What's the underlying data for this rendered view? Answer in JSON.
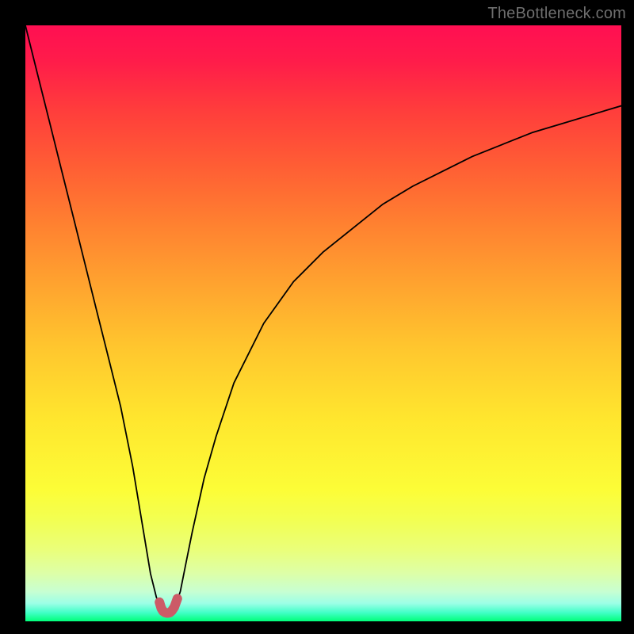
{
  "watermark": "TheBottleneck.com",
  "colors": {
    "background": "#000000",
    "curve_stroke": "#000000",
    "marker_stroke": "#cc5a67",
    "watermark": "#6e6e6e"
  },
  "chart_data": {
    "type": "line",
    "title": "",
    "xlabel": "",
    "ylabel": "",
    "xlim": [
      0,
      100
    ],
    "ylim": [
      0,
      100
    ],
    "grid": false,
    "series": [
      {
        "name": "bottleneck-curve",
        "x": [
          0,
          2,
          4,
          6,
          8,
          10,
          12,
          14,
          16,
          18,
          19,
          20,
          21,
          22,
          23,
          23.5,
          24,
          24.5,
          25,
          26,
          27,
          28,
          30,
          32,
          35,
          40,
          45,
          50,
          55,
          60,
          65,
          70,
          75,
          80,
          85,
          90,
          95,
          100
        ],
        "y": [
          100,
          92,
          84,
          76,
          68,
          60,
          52,
          44,
          36,
          26,
          20,
          14,
          8,
          4,
          2,
          1.5,
          1.4,
          1.5,
          2,
          5,
          10,
          15,
          24,
          31,
          40,
          50,
          57,
          62,
          66,
          70,
          73,
          75.5,
          78,
          80,
          82,
          83.5,
          85,
          86.5
        ]
      },
      {
        "name": "optimal-region-marker",
        "x": [
          22.5,
          22.8,
          23.1,
          23.4,
          23.7,
          24,
          24.3,
          24.6,
          25,
          25.5
        ],
        "y": [
          3.2,
          2.2,
          1.7,
          1.5,
          1.4,
          1.4,
          1.5,
          1.8,
          2.4,
          3.8
        ]
      }
    ]
  }
}
